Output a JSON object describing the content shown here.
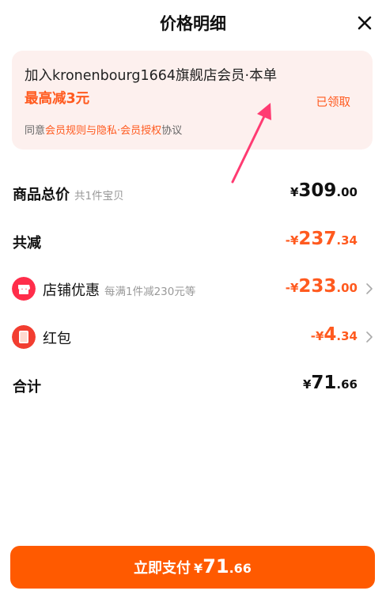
{
  "header": {
    "title": "价格明细"
  },
  "promo": {
    "line_prefix": "加入kronenbourg1664旗舰店会员·本单",
    "line_highlight": "最高减3元",
    "claimed_label": "已领取",
    "agree_prefix": "同意",
    "rules_link": "会员规则与隐私",
    "dot": "·",
    "auth_link": "会员授权",
    "agree_suffix": "协议"
  },
  "rows": {
    "total": {
      "label": "商品总价",
      "sub": "共1件宝贝",
      "currency": "¥",
      "int": "309",
      "dec": ".00"
    },
    "discount": {
      "label": "共减",
      "currency": "-¥",
      "int": "237",
      "dec": ".34"
    },
    "shop": {
      "label": "店铺优惠",
      "sub": "每满1件减230元等",
      "currency": "-¥",
      "int": "233",
      "dec": ".00"
    },
    "redpacket": {
      "label": "红包",
      "currency": "-¥",
      "int": "4",
      "dec": ".34",
      "icon_text": "¥"
    },
    "sum": {
      "label": "合计",
      "currency": "¥",
      "int": "71",
      "dec": ".66"
    }
  },
  "pay": {
    "label": "立即支付",
    "currency": "¥",
    "int": "71",
    "dec": ".66"
  },
  "colors": {
    "accent": "#ff5a1f",
    "button": "#ff5a00",
    "promo_bg": "#fdf0ee",
    "shop_icon": "#ff2d4a",
    "redpacket_icon": "#f23d30"
  }
}
